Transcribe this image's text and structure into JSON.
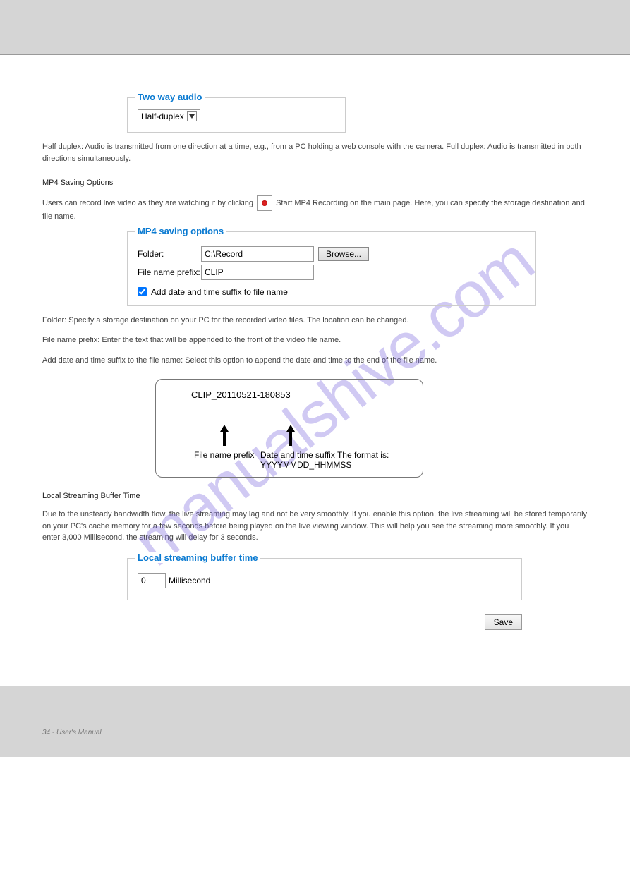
{
  "sections": {
    "twoway": {
      "legend": "Two way audio",
      "selected": "Half-duplex"
    },
    "twoway_desc": "Half duplex: Audio is transmitted from one direction at a time, e.g., from a PC holding a web console with the camera.\nFull duplex: Audio is transmitted in both directions simultaneously.",
    "mp4head": "MP4 Saving Options",
    "mp4": {
      "legend": "MP4 saving options",
      "folder_label": "Folder:",
      "folder_value": "C:\\Record",
      "browse": "Browse...",
      "prefix_label": "File name prefix:",
      "prefix_value": "CLIP",
      "add_suffix": "Add date and time suffix to file name"
    },
    "mp4_desc_2": "Folder: Specify a storage destination on your PC for the recorded video files. The location can be changed.",
    "mp4_desc_3": "File name prefix: Enter the text that will be appended to the front of the video file name.",
    "mp4_desc_4": "Add date and time suffix to the file name: Select this option to append the date and time to the end of the file name.",
    "format": {
      "sample": "CLIP_20110521-180853",
      "prefix_cap": "File name prefix",
      "suffix_cap": "Date and time suffix\nThe format is: YYYYMMDD_HHMMSS"
    },
    "bufferhead": "Local Streaming Buffer Time",
    "buffer_desc": "Due to the unsteady bandwidth flow, the live streaming may lag and not be very smoothly. If you enable this option, the live streaming will be stored temporarily on your PC's cache memory for a few seconds before being played on the live viewing window. This will help you see the streaming more smoothly. If you enter 3,000 Millisecond, the streaming will delay for 3 seconds.",
    "buffer": {
      "legend": "Local streaming buffer time",
      "value": "0",
      "unit": "Millisecond"
    },
    "save": "Save",
    "mp4_desc_1a": "Users can record live video as they are watching it by clicking ",
    "mp4_desc_1b": " Start MP4 Recording on the main page. Here, you can specify the storage destination and file name."
  },
  "footer": {
    "left": "34 - User's Manual",
    "right": ""
  },
  "watermark": "manualshive.com"
}
